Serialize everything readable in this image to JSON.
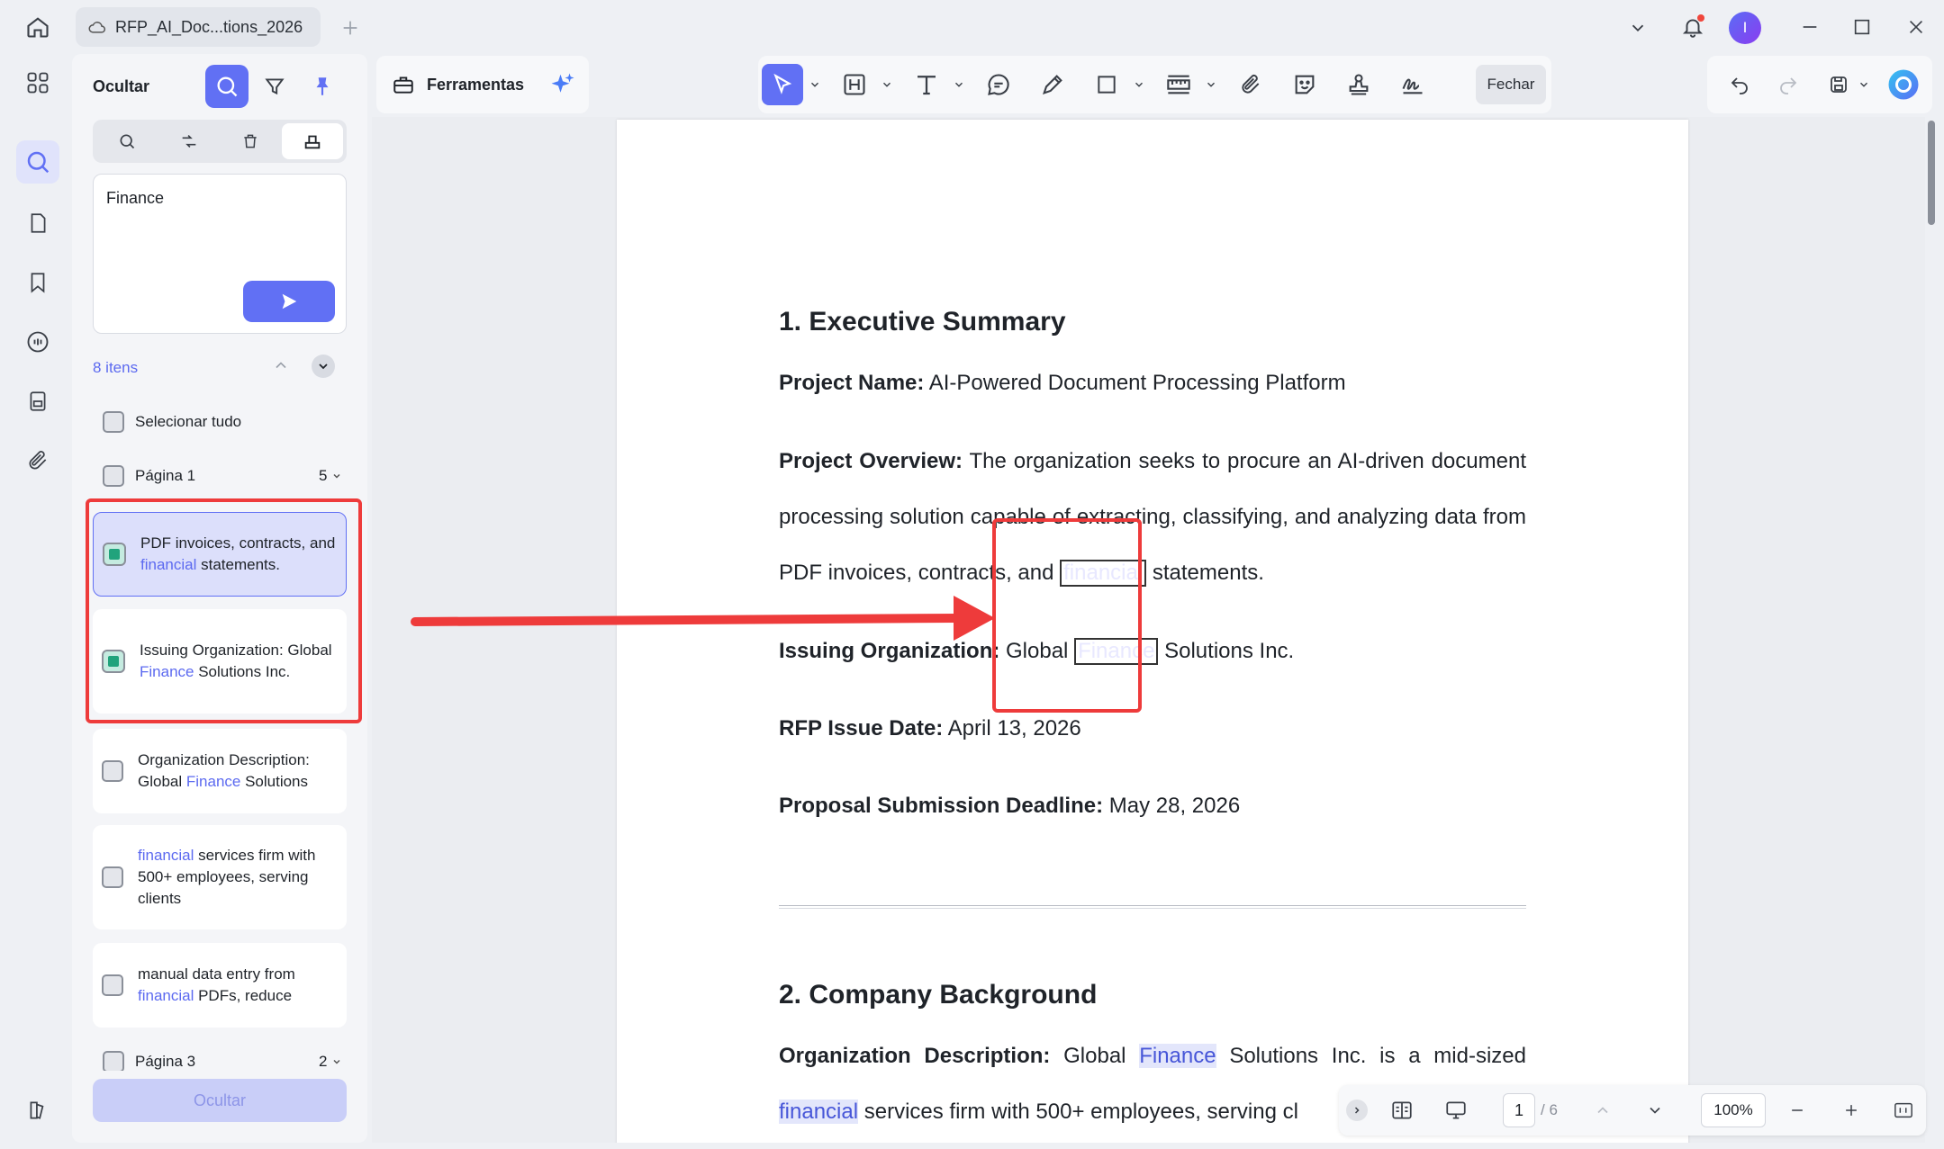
{
  "window": {
    "tab_title": "RFP_AI_Doc...tions_2026",
    "avatar_letter": "I"
  },
  "panel": {
    "title": "Ocultar",
    "search_value": "Finance",
    "count_label": "8 itens",
    "select_all": "Selecionar tudo",
    "page1_label": "Página 1",
    "page1_count": "5",
    "page3_label": "Página 3",
    "page3_count": "2",
    "hide_button": "Ocultar",
    "results": [
      {
        "pre": "PDF invoices, contracts, and ",
        "match": "financial",
        "post": " statements."
      },
      {
        "pre": "Issuing Organization: Global ",
        "match": "Finance",
        "post": " Solutions Inc."
      },
      {
        "pre": "Organization Description: Global ",
        "match": "Finance",
        "post": " Solutions"
      },
      {
        "pre": "",
        "match": "financial",
        "post": " services firm with 500+ employees, serving clients"
      },
      {
        "pre": "manual data entry from ",
        "match": "financial",
        "post": " PDFs, reduce"
      }
    ]
  },
  "toolbar": {
    "tools_label": "Ferramentas",
    "close_label": "Fechar"
  },
  "document": {
    "h1": "1. Executive Summary",
    "project_name_label": "Project Name:",
    "project_name_value": " AI-Powered Document Processing Platform",
    "overview_label": "Project Overview:",
    "overview_line1": " The organization seeks to procure an AI-driven document",
    "overview_line2": "processing solution capable of extracting, classifying, and analyzing data from",
    "overview_line3_pre": "PDF invoices, contracts, and ",
    "overview_line3_boxed": "financial",
    "overview_line3_post": " statements.",
    "issuing_label": "Issuing Organization:",
    "issuing_pre": " Global ",
    "issuing_boxed": "Finance",
    "issuing_post": " Solutions Inc.",
    "rfp_date_label": "RFP Issue Date:",
    "rfp_date_value": " April 13, 2026",
    "deadline_label": "Proposal Submission Deadline:",
    "deadline_value": " May 28, 2026",
    "h2": "2. Company Background",
    "orgdesc_label": "Organization Description:",
    "orgdesc_pre": " Global ",
    "orgdesc_match": "Finance",
    "orgdesc_post": " Solutions Inc. is a mid-sized",
    "line_last_match": "financial",
    "line_last_post": " services firm with 500+ employees, serving cl"
  },
  "pager": {
    "current_page": "1",
    "total_pages": "/ 6",
    "zoom": "100%"
  },
  "colors": {
    "accent": "#6170f4",
    "annotation_red": "#ee3b3b",
    "match_text": "#5c6af0"
  }
}
